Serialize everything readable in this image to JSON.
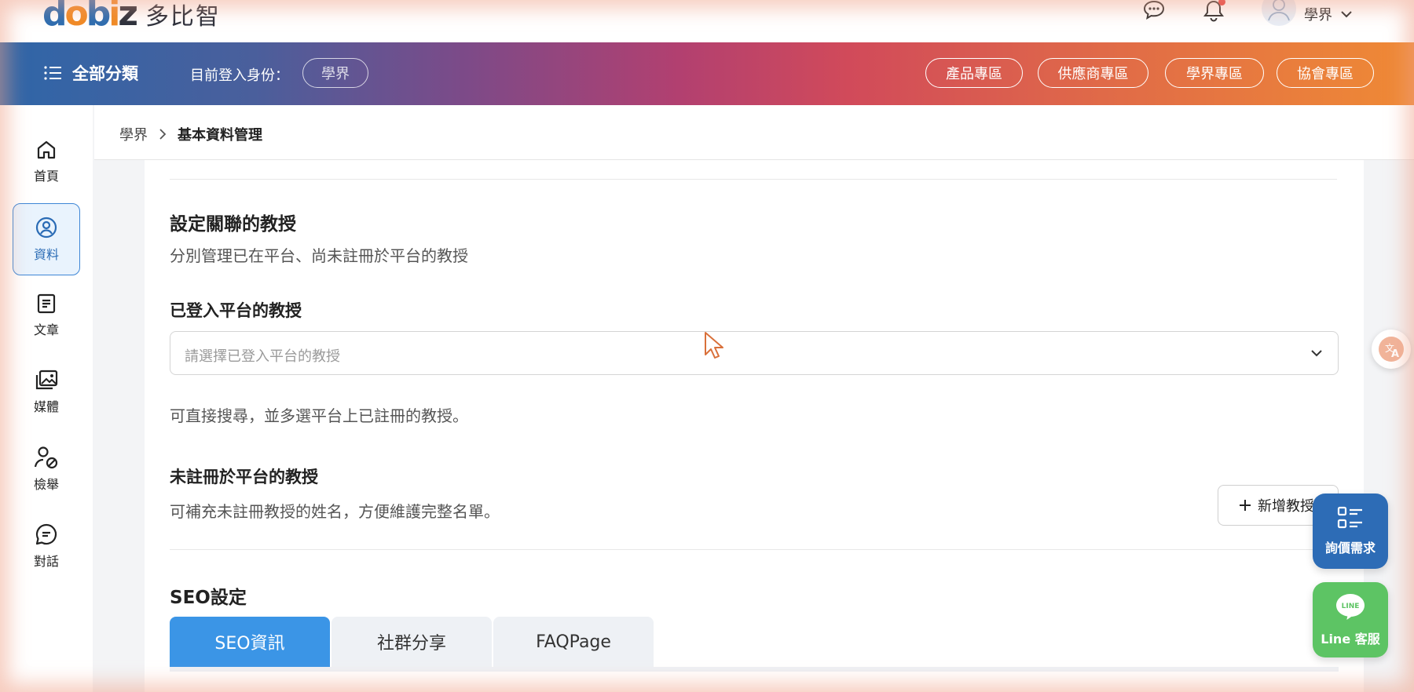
{
  "brand": {
    "logo_mark": "dobiz",
    "name": "多比智"
  },
  "topbar": {
    "user_name": "學界"
  },
  "header": {
    "all_categories": "全部分類",
    "login_label": "目前登入身份：",
    "login_role": "學界",
    "zones": [
      "產品專區",
      "供應商專區",
      "學界專區",
      "協會專區"
    ]
  },
  "sidebar": {
    "items": [
      {
        "label": "首頁",
        "icon": "home-icon"
      },
      {
        "label": "資料",
        "icon": "user-circle-icon"
      },
      {
        "label": "文章",
        "icon": "document-icon"
      },
      {
        "label": "媒體",
        "icon": "media-icon"
      },
      {
        "label": "檢舉",
        "icon": "report-user-icon"
      },
      {
        "label": "對話",
        "icon": "chat-icon"
      }
    ]
  },
  "breadcrumb": {
    "root": "學界",
    "current": "基本資料管理"
  },
  "section_professors": {
    "title": "設定關聯的教授",
    "description": "分別管理已在平台、尚未註冊於平台的教授",
    "registered_title": "已登入平台的教授",
    "select_placeholder": "請選擇已登入平台的教授",
    "registered_hint": "可直接搜尋，並多選平台上已註冊的教授。",
    "unregistered_title": "未註冊於平台的教授",
    "unregistered_hint": "可補充未註冊教授的姓名，方便維護完整名單。",
    "add_button": "新增教授"
  },
  "seo": {
    "title": "SEO設定",
    "tabs": [
      "SEO資訊",
      "社群分享",
      "FAQPage"
    ],
    "active_tab": "SEO資訊"
  },
  "floating": {
    "quote_label": "詢價需求",
    "line_label": "Line 客服",
    "line_logo": "LINE"
  },
  "colors": {
    "accent": "#3b95e6",
    "sidebar_active": "#2a6bb5",
    "line_green": "#5dc464",
    "quote_blue": "#2d6cb6"
  }
}
